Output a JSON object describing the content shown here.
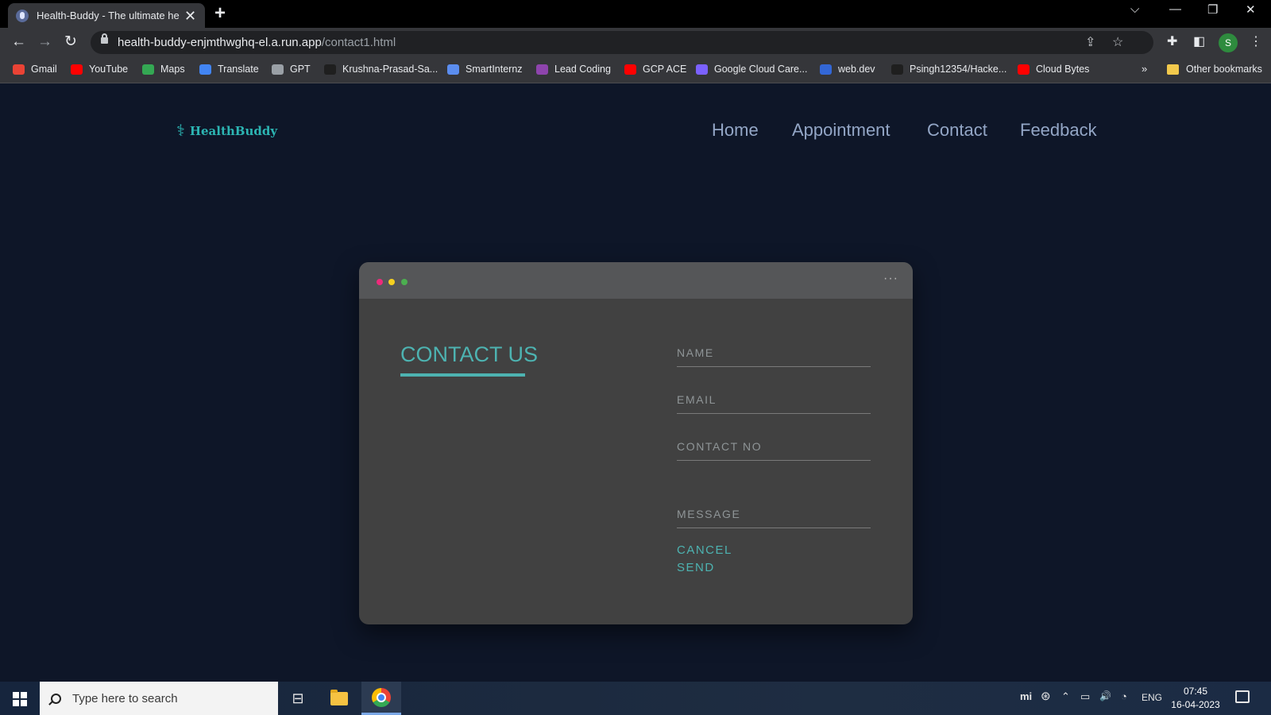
{
  "browser": {
    "tab_title": "Health-Buddy - The ultimate hea",
    "tab_close": "✕",
    "new_tab": "+",
    "window_controls": {
      "tab_search": "⌵",
      "minimize": "—",
      "restore": "❐",
      "close": "✕"
    },
    "nav": {
      "back": "←",
      "forward": "→",
      "reload": "↻"
    },
    "url_host": "health-buddy-enjmthwghq-el.a.run.app",
    "url_path": "/contact1.html",
    "omnibox_icons": {
      "share": "⇪",
      "bookmark_star": "☆"
    },
    "toolbar_icons": {
      "extensions": "✚",
      "side_panel": "◧",
      "menu": "⋮"
    },
    "profile_initial": "S",
    "bookmarks": [
      {
        "label": "Gmail",
        "color": "#ea4335"
      },
      {
        "label": "YouTube",
        "color": "#ff0000"
      },
      {
        "label": "Maps",
        "color": "#34a853"
      },
      {
        "label": "Translate",
        "color": "#4285f4"
      },
      {
        "label": "GPT",
        "color": "#9aa0a6"
      },
      {
        "label": "Krushna-Prasad-Sa...",
        "color": "#1f1f1f"
      },
      {
        "label": "SmartInternz",
        "color": "#5b8def"
      },
      {
        "label": "Lead Coding",
        "color": "#8e44ad"
      },
      {
        "label": "GCP ACE",
        "color": "#ff0000"
      },
      {
        "label": "Google Cloud Care...",
        "color": "#7b61ff"
      },
      {
        "label": "web.dev",
        "color": "#3367d6"
      },
      {
        "label": "Psingh12354/Hacke...",
        "color": "#1f1f1f"
      },
      {
        "label": "Cloud Bytes",
        "color": "#ff0000"
      }
    ],
    "bookmarks_overflow": "»",
    "other_bookmarks": "Other bookmarks"
  },
  "site": {
    "logo_text": "HealthBuddy",
    "logo_glyph": "⚕",
    "nav": {
      "home": "Home",
      "appointment": "Appointment",
      "contact": "Contact",
      "feedback": "Feedback"
    }
  },
  "card": {
    "dot_colors": [
      "#ee2a7b",
      "#f5d020",
      "#4caf50"
    ],
    "menu_glyph": "···",
    "title": "CONTACT US",
    "accent_color": "#4db3b1",
    "form": {
      "name_placeholder": "NAME",
      "email_placeholder": "EMAIL",
      "contact_placeholder": "CONTACT NO",
      "message_placeholder": "MESSAGE",
      "cancel_label": "CANCEL",
      "send_label": "SEND"
    }
  },
  "taskbar": {
    "search_placeholder": "Type here to search",
    "task_view_glyph": "⊟",
    "tray": {
      "mi": "mi",
      "steam": "⊛",
      "chevron": "⌃",
      "battery": "▭",
      "volume": "🔊",
      "wifi": "◔",
      "language": "ENG"
    },
    "time": "07:45",
    "date": "16-04-2023"
  }
}
